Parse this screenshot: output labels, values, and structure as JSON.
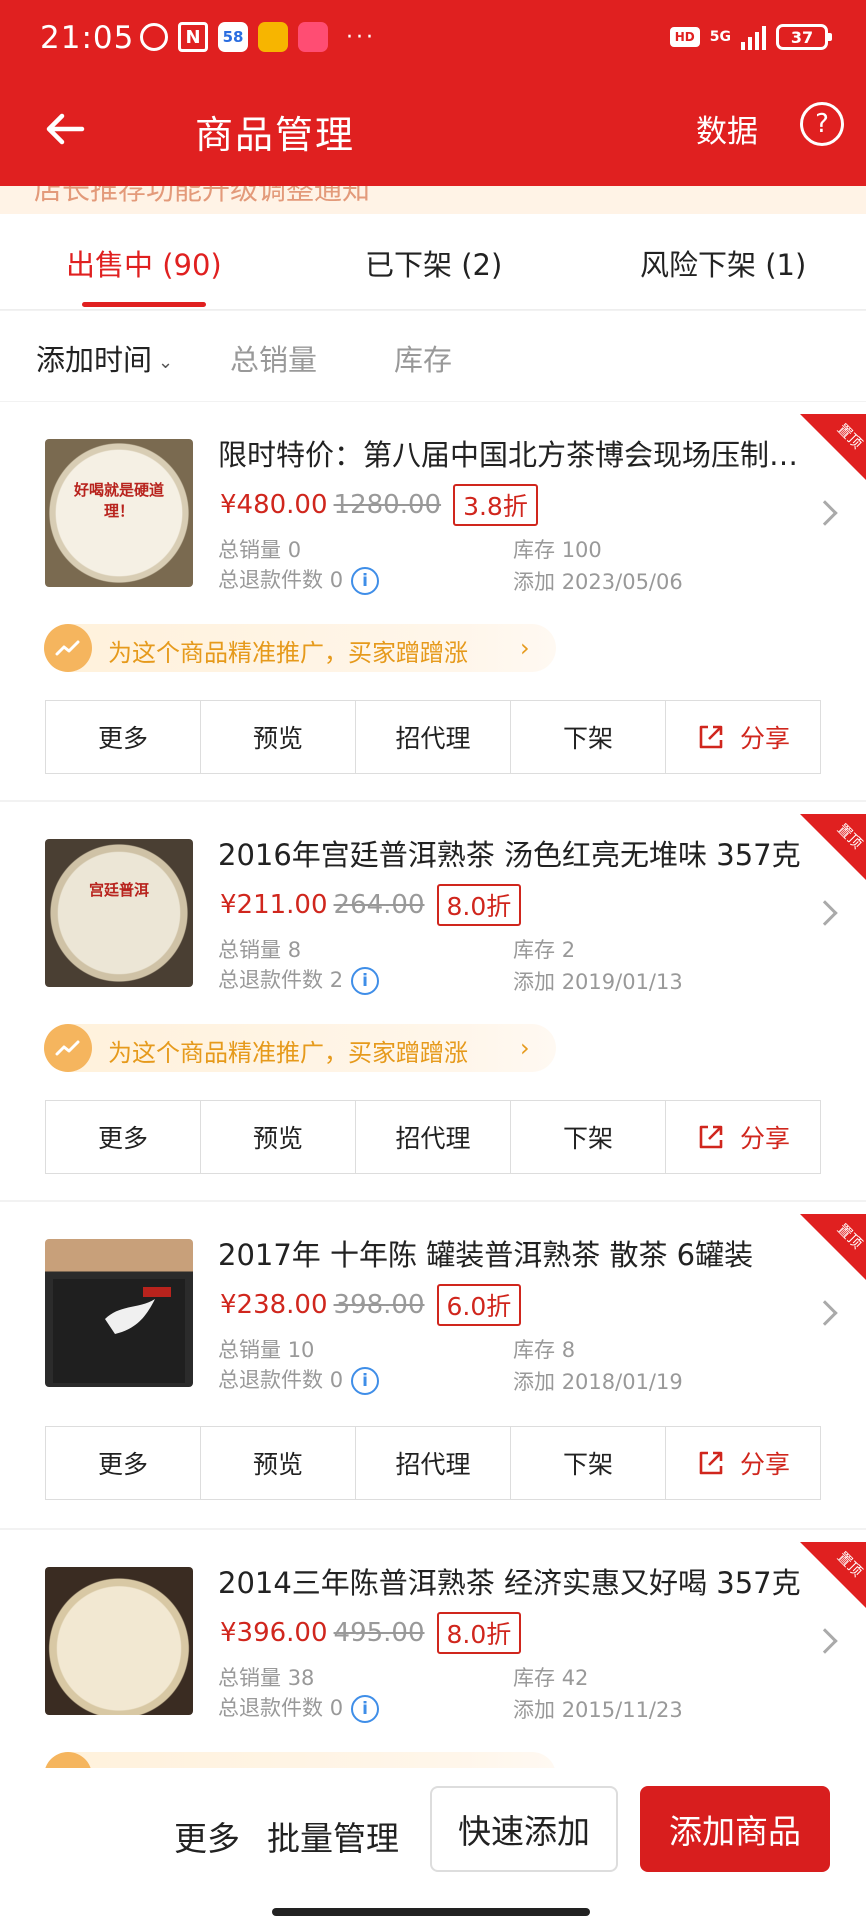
{
  "status_bar": {
    "time": "21:05",
    "signal_label": "5G",
    "hd_label": "HD",
    "battery": "37",
    "app_58": "58",
    "app_n": "N",
    "more_dots": "···"
  },
  "nav": {
    "title": "商品管理",
    "data_link": "数据",
    "help": "?"
  },
  "notice": "店长推荐功能升级调整通知",
  "tabs": [
    {
      "label": "出售中 (90)",
      "active": true
    },
    {
      "label": "已下架 (2)",
      "active": false
    },
    {
      "label": "风险下架 (1)",
      "active": false
    }
  ],
  "sort": [
    {
      "label": "添加时间",
      "active": true,
      "chevron": "⌄"
    },
    {
      "label": "总销量",
      "active": false
    },
    {
      "label": "库存",
      "active": false
    }
  ],
  "pin_label": "置顶",
  "labels": {
    "sales": "总销量",
    "stock": "库存",
    "refund": "总退款件数",
    "added": "添加",
    "info_icon": "i"
  },
  "promo": {
    "text": "为这个商品精准推广，买家蹭蹭涨",
    "chevron": "›"
  },
  "actions": [
    "更多",
    "预览",
    "招代理",
    "下架",
    "分享"
  ],
  "products": [
    {
      "title": "限时特价：第八届中国北方茶博会现场压制生茶饼",
      "price": "¥480.00",
      "original_price": "1280.00",
      "discount": "3.8折",
      "sales": "0",
      "stock": "100",
      "refunds": "0",
      "added": "2023/05/06",
      "thumb_text": "好喝就是硬道理！",
      "has_promo": true
    },
    {
      "title": "2016年宫廷普洱熟茶   汤色红亮无堆味 357克",
      "price": "¥211.00",
      "original_price": "264.00",
      "discount": "8.0折",
      "sales": "8",
      "stock": "2",
      "refunds": "2",
      "added": "2019/01/13",
      "thumb_text": "宫廷普洱",
      "has_promo": true
    },
    {
      "title": " 2017年 十年陈 罐装普洱熟茶   散茶 6罐装",
      "price": "¥238.00",
      "original_price": "398.00",
      "discount": "6.0折",
      "sales": "10",
      "stock": "8",
      "refunds": "0",
      "added": "2018/01/19",
      "thumb_text": "",
      "has_promo": false
    },
    {
      "title": "2014三年陈普洱熟茶  经济实惠又好喝  357克",
      "price": "¥396.00",
      "original_price": "495.00",
      "discount": "8.0折",
      "sales": "38",
      "stock": "42",
      "refunds": "0",
      "added": "2015/11/23",
      "thumb_text": "",
      "has_promo": true
    }
  ],
  "bottom_bar": {
    "more": "更多",
    "batch": "批量管理",
    "quick_add": "快速添加",
    "add_product": "添加商品"
  },
  "colors": {
    "brand_red": "#e02020",
    "price_red": "#d0261d",
    "promo_orange": "#e69a1c",
    "info_blue": "#3f8ee8"
  }
}
